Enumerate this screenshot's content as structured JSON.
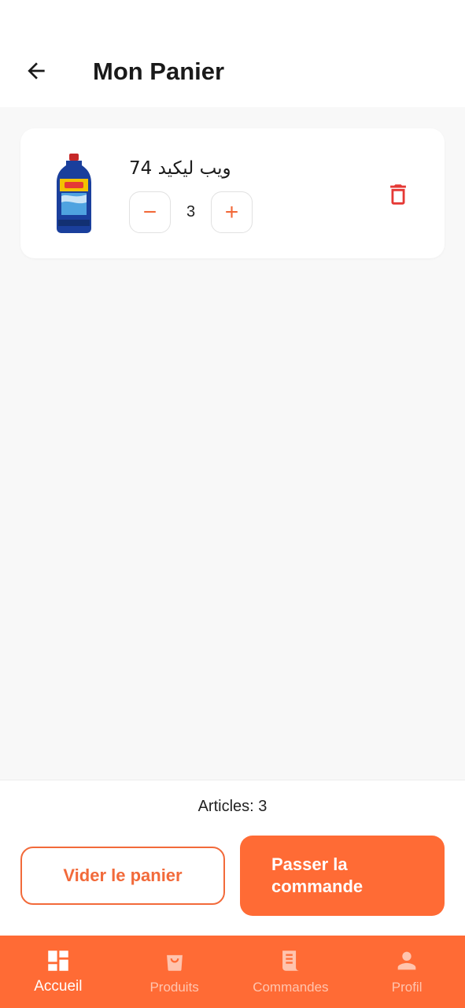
{
  "header": {
    "title": "Mon Panier",
    "back_icon": "arrow-left-icon"
  },
  "cart": {
    "items": [
      {
        "name": "ويب ليكيد 74",
        "quantity": "3",
        "image_icon": "detergent-bottle-icon"
      }
    ],
    "minus_label": "−",
    "plus_label": "+"
  },
  "summary": {
    "articles_label": "Articles: 3",
    "clear_button": "Vider le panier",
    "order_button": "Passer la commande"
  },
  "bottom_nav": {
    "items": [
      {
        "label": "Accueil",
        "icon": "dashboard-icon",
        "active": true
      },
      {
        "label": "Produits",
        "icon": "shopping-bag-icon",
        "active": false
      },
      {
        "label": "Commandes",
        "icon": "receipt-icon",
        "active": false
      },
      {
        "label": "Profil",
        "icon": "person-icon",
        "active": false
      }
    ]
  },
  "colors": {
    "accent": "#ff6b35",
    "delete": "#e53935",
    "background": "#f8f8f8"
  }
}
